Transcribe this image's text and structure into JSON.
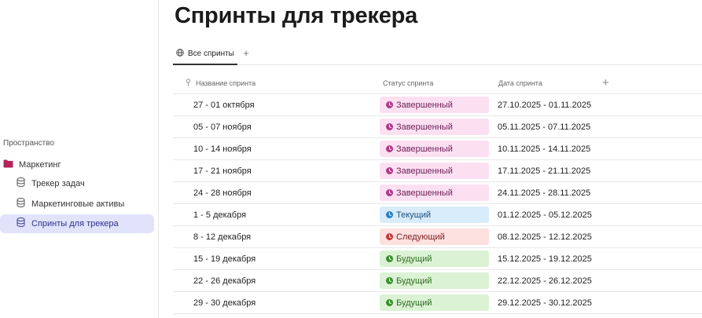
{
  "sidebar": {
    "section_label": "Пространство",
    "folder": {
      "label": "Маркетинг",
      "icon": "folder-icon",
      "color": "#b3245f"
    },
    "items": [
      {
        "label": "Трекер задач",
        "icon": "database-icon",
        "active": false
      },
      {
        "label": "Маркетинговые активы",
        "icon": "database-icon",
        "active": false
      },
      {
        "label": "Спринты для трекера",
        "icon": "database-icon",
        "active": true
      }
    ]
  },
  "page": {
    "title": "Спринты для трекера",
    "tabs": [
      {
        "label": "Все спринты",
        "icon": "globe-icon"
      }
    ],
    "add_tab": "+"
  },
  "table": {
    "columns": {
      "name": "Название спринта",
      "status": "Статус спринта",
      "date": "Дата спринта",
      "add": "+"
    },
    "rows": [
      {
        "name": "27 - 01 октября",
        "status": "Завершенный",
        "status_kind": "done",
        "date": "27.10.2025 - 01.11.2025"
      },
      {
        "name": "05 - 07 ноября",
        "status": "Завершенный",
        "status_kind": "done",
        "date": "05.11.2025 - 07.11.2025"
      },
      {
        "name": "10 - 14 ноября",
        "status": "Завершенный",
        "status_kind": "done",
        "date": "10.11.2025 - 14.11.2025"
      },
      {
        "name": "17 - 21 ноября",
        "status": "Завершенный",
        "status_kind": "done",
        "date": "17.11.2025 - 21.11.2025"
      },
      {
        "name": "24 - 28 ноября",
        "status": "Завершенный",
        "status_kind": "done",
        "date": "24.11.2025 - 28.11.2025"
      },
      {
        "name": "1 - 5 декабря",
        "status": "Текущий",
        "status_kind": "current",
        "date": "01.12.2025 - 05.12.2025"
      },
      {
        "name": "8 - 12 декабря",
        "status": "Следующий",
        "status_kind": "next",
        "date": "08.12.2025 - 12.12.2025"
      },
      {
        "name": "15 - 19 декабря",
        "status": "Будущий",
        "status_kind": "future",
        "date": "15.12.2025 - 19.12.2025"
      },
      {
        "name": "22 - 26 декабря",
        "status": "Будущий",
        "status_kind": "future",
        "date": "22.12.2025 - 26.12.2025"
      },
      {
        "name": "29 - 30 декабря",
        "status": "Будущий",
        "status_kind": "future",
        "date": "29.12.2025 - 30.12.2025"
      }
    ]
  },
  "status_colors": {
    "done": "#b0398a",
    "current": "#2f7fc2",
    "next": "#c23b3b",
    "future": "#3c8f2e"
  }
}
